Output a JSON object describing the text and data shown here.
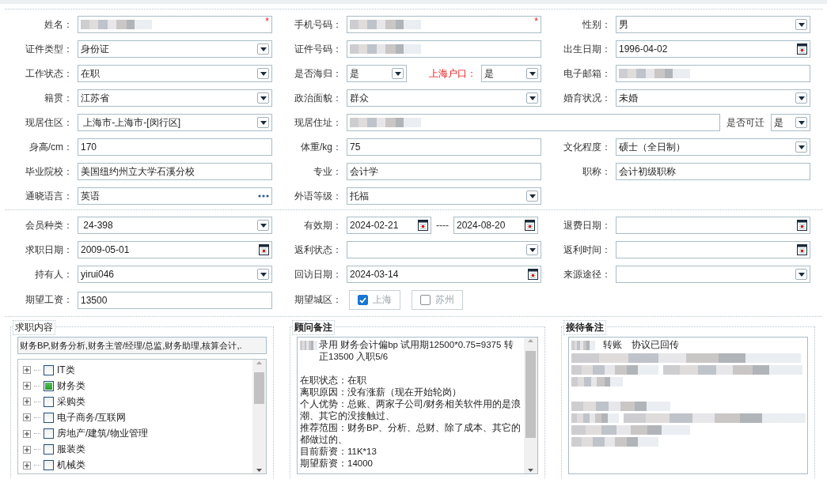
{
  "sections": [
    {
      "fields": [
        {
          "label": "姓名：",
          "kind": "blurred",
          "required_mark": "*"
        },
        {
          "label": "手机号码：",
          "kind": "blurred",
          "required_mark": "*"
        },
        {
          "label": "性别：",
          "kind": "select",
          "value": "男"
        },
        {
          "label": "证件类型：",
          "kind": "select",
          "value": "身份证"
        },
        {
          "label": "证件号码：",
          "kind": "blurred"
        },
        {
          "label": "出生日期：",
          "kind": "date",
          "value": "1996-04-02"
        },
        {
          "label": "工作状态：",
          "kind": "select",
          "value": "在职"
        },
        {
          "label": "是否海归：",
          "kind": "pair",
          "items": [
            {
              "kind": "select",
              "value": "是"
            },
            {
              "label": "上海户口：",
              "highlight": true,
              "kind": "select",
              "value": "是"
            }
          ]
        },
        {
          "label": "电子邮箱：",
          "kind": "blurred"
        },
        {
          "label": "籍贯：",
          "kind": "select",
          "value": "江苏省"
        },
        {
          "label": "政治面貌：",
          "kind": "select",
          "value": "群众"
        },
        {
          "label": "婚育状况：",
          "kind": "select",
          "value": "未婚"
        },
        {
          "label": "现居住区：",
          "kind": "select",
          "value": " 上海市-上海市-[闵行区]"
        },
        {
          "label": "现居住址：",
          "kind": "wide",
          "items": [
            {
              "kind": "blurred"
            },
            {
              "label": "是否可迁",
              "highlight": false,
              "kind": "select",
              "value": "是"
            }
          ]
        },
        {
          "label": "身高/cm：",
          "kind": "text",
          "value": "170"
        },
        {
          "label": "体重/kg：",
          "kind": "text",
          "value": "75"
        },
        {
          "label": "文化程度：",
          "kind": "select",
          "value": "硕士（全日制）"
        },
        {
          "label": "毕业院校：",
          "kind": "text",
          "value": "美国纽约州立大学石溪分校"
        },
        {
          "label": "专业：",
          "kind": "text",
          "value": "会计学"
        },
        {
          "label": "职称：",
          "kind": "text",
          "value": "会计初级职称"
        },
        {
          "label": "通晓语言：",
          "kind": "dots",
          "value": "英语"
        },
        {
          "label": "外语等级：",
          "kind": "select",
          "value": "托福"
        }
      ]
    },
    {
      "fields": [
        {
          "label": "会员种类：",
          "kind": "select",
          "value": " 24-398"
        },
        {
          "label": "有效期：",
          "kind": "range",
          "separator": "----",
          "values": [
            "2024-02-21",
            "2024-08-20"
          ]
        },
        {
          "label": "退费日期：",
          "kind": "date"
        },
        {
          "label": "求职日期：",
          "kind": "date",
          "value": "2009-05-01"
        },
        {
          "label": "返利状态：",
          "kind": "select"
        },
        {
          "label": "返利时间：",
          "kind": "date"
        },
        {
          "label": "持有人：",
          "kind": "select",
          "value": "yirui046"
        },
        {
          "label": "回访日期：",
          "kind": "date",
          "value": "2024-03-14"
        },
        {
          "label": "来源途径：",
          "kind": "select"
        },
        {
          "label": "期望工资：",
          "kind": "text",
          "value": "13500"
        },
        {
          "label": "期望城区：",
          "kind": "checks",
          "options": [
            {
              "label": "上海",
              "checked": true
            },
            {
              "label": "苏州",
              "checked": false
            }
          ]
        }
      ]
    }
  ],
  "job_intent": {
    "title": "求职内容",
    "summary": "财务BP,财务分析,财务主管/经理/总监,财务助理,核算会计,.",
    "categories": [
      {
        "label": "IT类",
        "checked": false,
        "expanded": false
      },
      {
        "label": "财务类",
        "checked": true,
        "expanded": false
      },
      {
        "label": "采购类",
        "checked": false,
        "expanded": false
      },
      {
        "label": "电子商务/互联网",
        "checked": false,
        "expanded": false
      },
      {
        "label": "房地产/建筑/物业管理",
        "checked": false,
        "expanded": false
      },
      {
        "label": "服装类",
        "checked": false,
        "expanded": false
      },
      {
        "label": "机械类",
        "checked": false,
        "expanded": false
      }
    ]
  },
  "advisor_notes": {
    "title": "顾问备注",
    "paragraphs": [
      [
        "录用 财务会计偏bp 试用期12500*0.75=9375 转正13500 入职5/6"
      ],
      [
        "在职状态：在职",
        "离职原因：没有涨薪（现在开始轮岗）",
        "个人优势：总账、两家子公司/财务相关软件用的是浪潮、其它的没接触过、",
        "推荐范围：财务BP、分析、总财、除了成本、其它的都做过的、",
        "目前薪资：11K*13",
        "期望薪资：14000"
      ]
    ]
  },
  "reception_notes": {
    "title": "接待备注",
    "text": "转账　协议已回传"
  }
}
